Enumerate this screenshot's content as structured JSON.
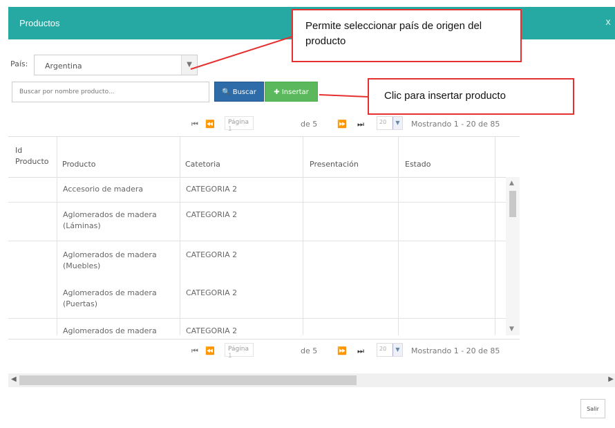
{
  "dialog": {
    "title": "Productos",
    "close": "x"
  },
  "filter": {
    "country_label": "País:",
    "country_value": "Argentina",
    "search_placeholder": "Buscar por nombre producto...",
    "search_button": "Buscar",
    "insert_button": "Insertar"
  },
  "pager": {
    "page_label": "Página",
    "page_value": "1",
    "of_label": "de 5",
    "page_size": "20",
    "showing": "Mostrando 1 - 20 de 85"
  },
  "table": {
    "columns": [
      "Id Producto",
      "Producto",
      "Catetoria",
      "Presentación",
      "Estado"
    ],
    "rows": [
      {
        "product": "Accesorio de madera",
        "category": "CATEGORIA 2"
      },
      {
        "product": "Aglomerados de madera (Láminas)",
        "category": "CATEGORIA 2"
      },
      {
        "product": "Aglomerados de madera (Muebles)",
        "category": "CATEGORIA 2"
      },
      {
        "product": "Aglomerados de madera (Puertas)",
        "category": "CATEGORIA 2"
      },
      {
        "product": "Aglomerados de madera",
        "category": "CATEGORIA 2"
      }
    ]
  },
  "footer": {
    "exit_button": "Salir"
  },
  "callouts": {
    "country": "Permite seleccionar país de origen del producto",
    "insert": "Clic para insertar producto"
  },
  "colors": {
    "header": "#27a9a3",
    "search_button": "#2d6ca8",
    "insert_button": "#5cb85c",
    "callout_border": "#e53030"
  },
  "icons": [
    "search-icon",
    "plus-icon",
    "first-page-icon",
    "prev-page-icon",
    "next-page-icon",
    "last-page-icon",
    "chevron-down-icon",
    "close-icon"
  ]
}
